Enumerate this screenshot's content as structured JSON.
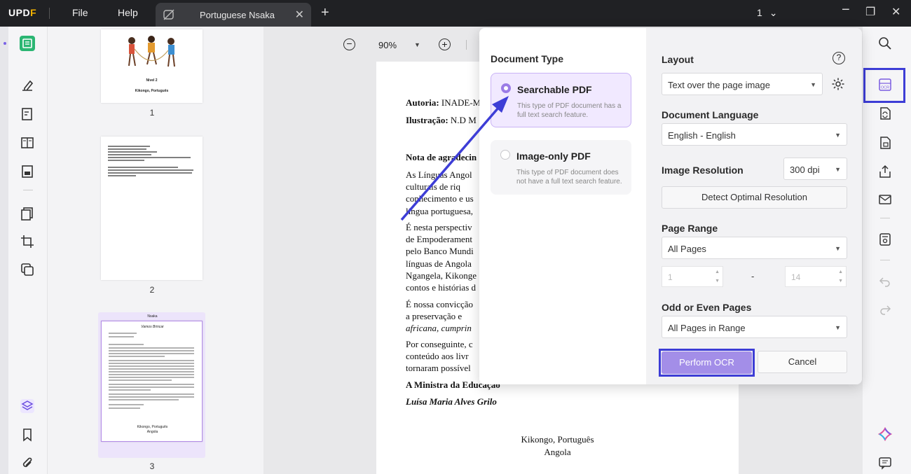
{
  "app": {
    "logo_part1": "UPD",
    "logo_part2": "F",
    "menu": [
      "File",
      "Help"
    ],
    "tab_title": "Portuguese Nsaka",
    "page_indicator": "1"
  },
  "zoom": {
    "value": "90%"
  },
  "thumbnails": [
    {
      "number": "1",
      "line1": "Nível 2",
      "line2": "Kikongo, Português"
    },
    {
      "number": "2"
    },
    {
      "number": "3",
      "header": "Nsaka",
      "title": "Vamos Brincar",
      "footer1": "Kikongo, Português",
      "footer2": "Angola"
    }
  ],
  "document": {
    "autoria_label": "Autoria:",
    "autoria_value": "INADE-M",
    "ilustracao_label": "Ilustração:",
    "ilustracao_value": "N.D M",
    "nota_title": "Nota de agradecin",
    "p1": [
      "As Línguas Angol",
      "culturais de riq",
      "conhecimento e us",
      "língua portuguesa,"
    ],
    "p2": [
      "É nesta perspectiv",
      "de Empoderament",
      "pelo Banco Mundi",
      "línguas de Angola",
      "Ngangela, Kikonge",
      "contos e histórias d"
    ],
    "p3": [
      "É nossa convicção",
      "a preservação e",
      "africana, cumprin"
    ],
    "p4": [
      "Por conseguinte, c",
      "conteúdo aos livr",
      "tornaram possível"
    ],
    "ministra": "A Ministra da Educação",
    "nome": "Luísa Maria Alves Grilo",
    "footer1": "Kikongo, Português",
    "footer2": "Angola"
  },
  "ocr_dialog": {
    "document_type_label": "Document Type",
    "options": [
      {
        "title": "Searchable PDF",
        "description": "This type of PDF document has a full text search feature.",
        "selected": true
      },
      {
        "title": "Image-only PDF",
        "description": "This type of PDF document does not have a full text search feature.",
        "selected": false
      }
    ],
    "layout_label": "Layout",
    "layout_value": "Text over the page image",
    "language_label": "Document Language",
    "language_value": "English - English",
    "resolution_label": "Image Resolution",
    "resolution_value": "300 dpi",
    "detect_button": "Detect Optimal Resolution",
    "page_range_label": "Page Range",
    "page_range_value": "All Pages",
    "range_from": "1",
    "range_dash": "-",
    "range_to": "14",
    "odd_even_label": "Odd or Even Pages",
    "odd_even_value": "All Pages in Range",
    "perform_button": "Perform OCR",
    "cancel_button": "Cancel"
  },
  "colors": {
    "accent": "#3d3dd6",
    "selected_option_bg": "#f1e9ff",
    "selected_option_border": "#c9b3f5",
    "perform_button_bg": "#a38ee8",
    "radio_selected": "#9b7ce6"
  }
}
